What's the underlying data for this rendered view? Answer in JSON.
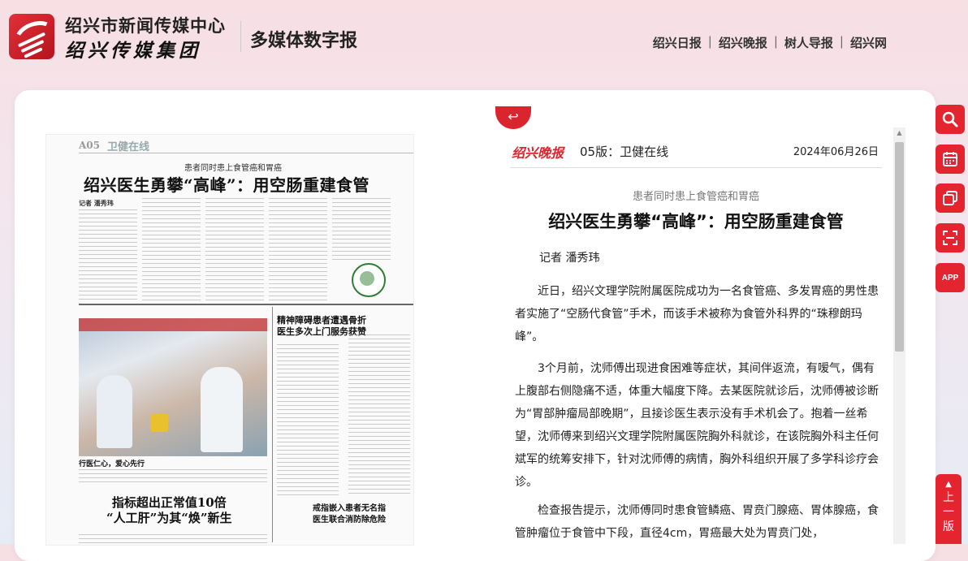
{
  "header": {
    "brand_top": "绍兴市新闻传媒中心",
    "brand_bottom": "绍兴传媒集团",
    "brand_title": "多媒体数字报",
    "links": [
      "绍兴日报",
      "绍兴晚报",
      "树人导报",
      "绍兴网"
    ]
  },
  "newspaper_page": {
    "page_number": "A05",
    "section": "卫健在线",
    "kicker": "患者同时患上食管癌和胃癌",
    "headline": "绍兴医生勇攀“高峰”：用空肠重建食管",
    "byline": "记者 潘秀玮",
    "photo_caption": "行医仁心，爱心先行",
    "sub_headline": "精神障碍患者遭遇骨折\n医生多次上门服务获赞",
    "lower_headline": "指标超出正常值10倍\n“人工肝”为其“焕”新生",
    "lower_sub_headline": "戒指嵌入患者无名指\n医生联合消防除危险"
  },
  "article": {
    "paper_logo": "绍兴晚报",
    "edition": "05版：卫健在线",
    "date": "2024年06月26日",
    "kicker": "患者同时患上食管癌和胃癌",
    "title": "绍兴医生勇攀“高峰”：用空肠重建食管",
    "author": "记者 潘秀玮",
    "paragraphs": [
      "近日，绍兴文理学院附属医院成功为一名食管癌、多发胃癌的男性患者实施了“空肠代食管”手术，而该手术被称为食管外科界的“珠穆朗玛峰”。",
      "3个月前，沈师傅出现进食困难等症状，其间伴返流，有嗳气，偶有上腹部右侧隐痛不适，体重大幅度下降。去某医院就诊后，沈师傅被诊断为“胃部肿瘤局部晚期”，且接诊医生表示没有手术机会了。抱着一丝希望，沈师傅来到绍兴文理学院附属医院胸外科就诊，在该院胸外科主任何斌军的统筹安排下，针对沈师傅的病情，胸外科组织开展了多学科诊疗会诊。",
      "检查报告提示，沈师傅同时患食管鳞癌、胃贲门腺癌、胃体腺癌，食管肿瘤位于食管中下段，直径4cm，胃癌最大处为胃贲门处，"
    ]
  },
  "side_tools": {
    "icons": [
      "search-icon",
      "calendar-icon",
      "copy-icon",
      "scan-icon",
      "app-icon"
    ],
    "app_label": "APP",
    "prev_label": "上一版"
  },
  "colors": {
    "accent": "#e4242e",
    "paper_red": "#d9262e"
  }
}
